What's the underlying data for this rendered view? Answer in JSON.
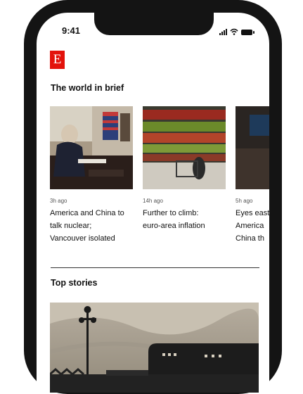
{
  "status_bar": {
    "time": "9:41"
  },
  "app": {
    "logo_letter": "E",
    "brand_color": "#e3120b"
  },
  "brief": {
    "title": "The world in brief",
    "cards": [
      {
        "meta": "3h ago",
        "headline": "America and China to\ntalk nuclear;\nVancouver isolated"
      },
      {
        "meta": "14h ago",
        "headline": "Further to climb:\neuro-area inflation"
      },
      {
        "meta": "5h ago",
        "headline": "Eyes east\nAmerica\nChina th"
      }
    ]
  },
  "top_stories": {
    "title": "Top stories"
  },
  "icons": [
    "signal-icon",
    "wifi-icon",
    "battery-icon"
  ]
}
